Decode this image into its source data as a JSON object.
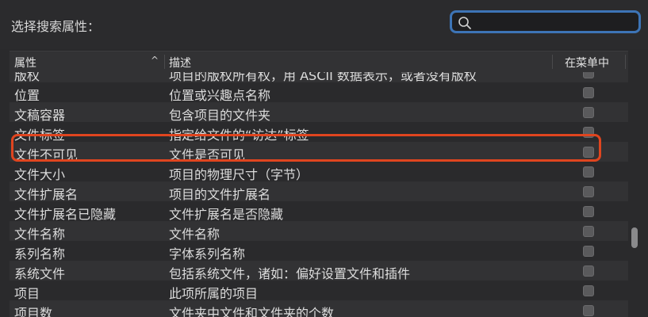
{
  "header": {
    "prompt": "选择搜索属性："
  },
  "search": {
    "placeholder": "",
    "value": ""
  },
  "table": {
    "columns": {
      "attribute": "属性",
      "description": "描述",
      "in_menu": "在菜单中"
    },
    "rows": [
      {
        "attr": "版权",
        "desc": "项目的版权所有权，用 ASCII 数据表示，或者没有版权",
        "in_menu": false
      },
      {
        "attr": "位置",
        "desc": "位置或兴趣点名称",
        "in_menu": false
      },
      {
        "attr": "文稿容器",
        "desc": "包含项目的文件夹",
        "in_menu": false
      },
      {
        "attr": "文件标签",
        "desc": "指定给文件的“访达”标签",
        "in_menu": false
      },
      {
        "attr": "文件不可见",
        "desc": "文件是否可见",
        "in_menu": false
      },
      {
        "attr": "文件大小",
        "desc": "项目的物理尺寸（字节）",
        "in_menu": false
      },
      {
        "attr": "文件扩展名",
        "desc": "项目的文件扩展名",
        "in_menu": false
      },
      {
        "attr": "文件扩展名已隐藏",
        "desc": "文件扩展名是否隐藏",
        "in_menu": false
      },
      {
        "attr": "文件名称",
        "desc": "文件名称",
        "in_menu": false
      },
      {
        "attr": "系列名称",
        "desc": "字体系列名称",
        "in_menu": false
      },
      {
        "attr": "系统文件",
        "desc": "包括系统文件，诸如：偏好设置文件和插件",
        "in_menu": false
      },
      {
        "attr": "项目",
        "desc": "此项所属的项目",
        "in_menu": false
      },
      {
        "attr": "项目数",
        "desc": "文件夹中文件和文件夹的个数",
        "in_menu": false
      }
    ]
  },
  "colors": {
    "highlight": "#e0451f",
    "search_border": "#3d74b6"
  }
}
